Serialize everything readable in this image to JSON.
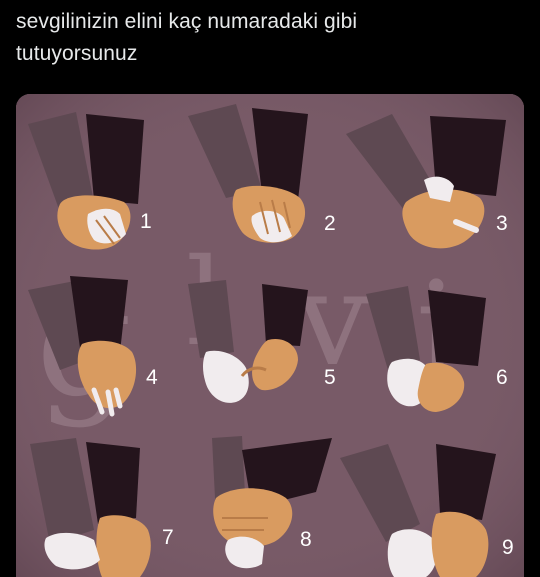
{
  "post": {
    "text_line1": "sevgilinizin elini kaç numaradaki gibi",
    "text_line2": "tutuyorsunuz"
  },
  "image": {
    "watermark": [
      "g",
      "l",
      "v",
      "j"
    ],
    "panel_numbers": [
      "1",
      "2",
      "3",
      "4",
      "5",
      "6",
      "7",
      "8",
      "9"
    ],
    "colors": {
      "background": "#785a67",
      "sleeve_dark": "#24141c",
      "sleeve_grey": "#5e4952",
      "skin_tan": "#d99b60",
      "hand_white": "#f1ecee"
    }
  }
}
